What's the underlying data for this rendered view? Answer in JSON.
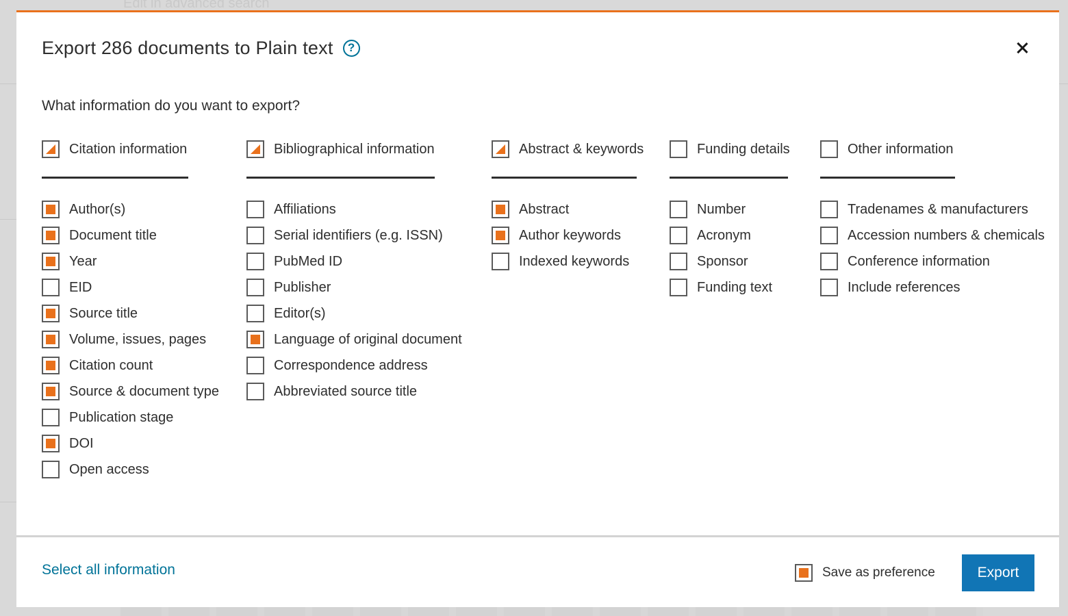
{
  "background": {
    "ghost_link": "Edit in advanced search"
  },
  "dialog": {
    "title": "Export 286 documents to Plain text",
    "help_icon": "?",
    "question": "What information do you want to export?"
  },
  "colors": {
    "accent": "#e9711c",
    "link": "#007398",
    "button": "#1175b5",
    "top_border": "#e9711c"
  },
  "columns": [
    {
      "heading": "Citation information",
      "state": "partial",
      "items": [
        {
          "label": "Author(s)",
          "checked": true
        },
        {
          "label": "Document title",
          "checked": true
        },
        {
          "label": "Year",
          "checked": true
        },
        {
          "label": "EID",
          "checked": false
        },
        {
          "label": "Source title",
          "checked": true
        },
        {
          "label": "Volume, issues, pages",
          "checked": true
        },
        {
          "label": "Citation count",
          "checked": true
        },
        {
          "label": "Source & document type",
          "checked": true
        },
        {
          "label": "Publication stage",
          "checked": false
        },
        {
          "label": "DOI",
          "checked": true
        },
        {
          "label": "Open access",
          "checked": false
        }
      ]
    },
    {
      "heading": "Bibliographical information",
      "state": "partial",
      "items": [
        {
          "label": "Affiliations",
          "checked": false
        },
        {
          "label": "Serial identifiers (e.g. ISSN)",
          "checked": false
        },
        {
          "label": "PubMed ID",
          "checked": false
        },
        {
          "label": "Publisher",
          "checked": false
        },
        {
          "label": "Editor(s)",
          "checked": false
        },
        {
          "label": "Language of original document",
          "checked": true
        },
        {
          "label": "Correspondence address",
          "checked": false
        },
        {
          "label": "Abbreviated source title",
          "checked": false
        }
      ]
    },
    {
      "heading": "Abstract & keywords",
      "state": "partial",
      "items": [
        {
          "label": "Abstract",
          "checked": true
        },
        {
          "label": "Author keywords",
          "checked": true
        },
        {
          "label": "Indexed keywords",
          "checked": false
        }
      ]
    },
    {
      "heading": "Funding details",
      "state": "unchecked",
      "items": [
        {
          "label": "Number",
          "checked": false
        },
        {
          "label": "Acronym",
          "checked": false
        },
        {
          "label": "Sponsor",
          "checked": false
        },
        {
          "label": "Funding text",
          "checked": false
        }
      ]
    },
    {
      "heading": "Other information",
      "state": "unchecked",
      "items": [
        {
          "label": "Tradenames & manufacturers",
          "checked": false
        },
        {
          "label": "Accession numbers & chemicals",
          "checked": false
        },
        {
          "label": "Conference information",
          "checked": false
        },
        {
          "label": "Include references",
          "checked": false
        }
      ]
    }
  ],
  "footer": {
    "select_all": "Select all information",
    "save_preference": "Save as preference",
    "save_preference_checked": true,
    "export_button": "Export"
  }
}
